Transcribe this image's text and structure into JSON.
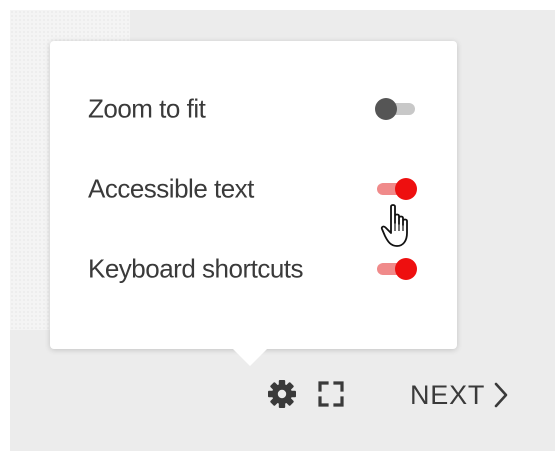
{
  "settings": {
    "items": [
      {
        "label": "Zoom to fit",
        "state": "off"
      },
      {
        "label": "Accessible text",
        "state": "on"
      },
      {
        "label": "Keyboard shortcuts",
        "state": "on"
      }
    ]
  },
  "toolbar": {
    "settings_icon": "gear-icon",
    "fullscreen_icon": "fullscreen-icon",
    "next_label": "NEXT",
    "next_icon": "chevron-right-icon"
  },
  "colors": {
    "toggle_on_thumb": "#ee0f0f",
    "toggle_on_track": "#f08a8a",
    "toggle_off_thumb": "#555555",
    "toggle_off_track": "#c8c8c8",
    "text": "#3a3a3a",
    "background": "#ececec"
  }
}
